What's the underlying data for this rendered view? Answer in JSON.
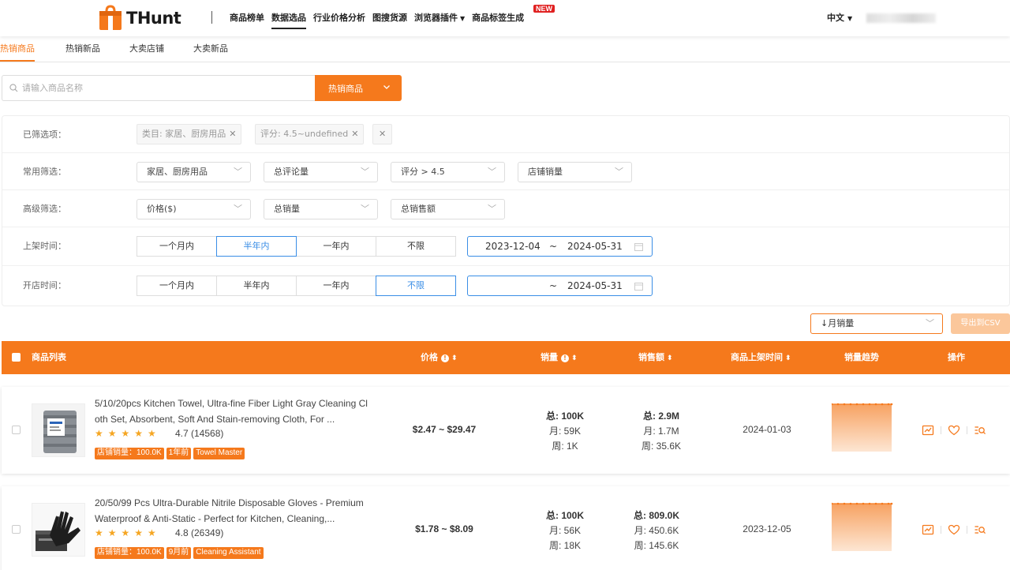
{
  "brand": {
    "name": "THunt",
    "accent": "#f5791c",
    "new_badge": "NEW"
  },
  "nav": {
    "items": [
      {
        "label": "商品榜单"
      },
      {
        "label": "数据选品"
      },
      {
        "label": "行业价格分析"
      },
      {
        "label": "图搜货源"
      },
      {
        "label": "浏览器插件"
      },
      {
        "label": "商品标签生成"
      }
    ],
    "language": "中文"
  },
  "tabs": [
    {
      "label": "热销商品"
    },
    {
      "label": "热销新品"
    },
    {
      "label": "大卖店铺"
    },
    {
      "label": "大卖新品"
    }
  ],
  "search": {
    "placeholder": "请输入商品名称",
    "scope": "热销商品"
  },
  "filters": {
    "selected_label": "已筛选项：",
    "selected_chips": [
      "类目: 家居、厨房用品",
      "评分: 4.5~undefined"
    ],
    "common_label": "常用筛选：",
    "common": [
      "家居、厨房用品",
      "总评论量",
      "评分 > 4.5",
      "店铺销量"
    ],
    "advanced_label": "高级筛选：",
    "advanced": [
      "价格($)",
      "总销量",
      "总销售额"
    ],
    "listed_label": "上架时间：",
    "listed_options": [
      "一个月内",
      "半年内",
      "一年内",
      "不限"
    ],
    "listed_range": {
      "start": "2023-12-04",
      "sep": "~",
      "end": "2024-05-31"
    },
    "shop_label": "开店时间：",
    "shop_options": [
      "一个月内",
      "半年内",
      "一年内",
      "不限"
    ],
    "shop_range": {
      "start": "",
      "sep": "~",
      "end": "2024-05-31"
    }
  },
  "sort": {
    "value": "↓月销量"
  },
  "export_label": "导出到CSV",
  "table": {
    "headers": {
      "list": "商品列表",
      "price": "价格",
      "sales": "销量",
      "revenue": "销售额",
      "listed": "商品上架时间",
      "trend": "销量趋势",
      "ops": "操作"
    },
    "rows": [
      {
        "title": "5/10/20pcs Kitchen Towel, Ultra-fine Fiber Light Gray Cleaning Cloth Set, Absorbent, Soft And Stain-removing Cloth, For ...",
        "stars": "★★★★★",
        "rating": "4.7 (14568)",
        "tags": [
          "店铺销量：100.0K",
          "1年前",
          "Towel Master"
        ],
        "price": "$2.47 ~ $29.47",
        "sales": {
          "total": "总: 100K",
          "month": "月: 59K",
          "week": "周: 1K"
        },
        "revenue": {
          "total": "总: 2.9M",
          "month": "月: 1.7M",
          "week": "周: 35.6K"
        },
        "listed": "2024-01-03"
      },
      {
        "title": "20/50/99 Pcs Ultra-Durable Nitrile Disposable Gloves - Premium Waterproof & Anti-Static - Perfect for Kitchen, Cleaning,...",
        "stars": "★★★★★",
        "rating": "4.8 (26349)",
        "tags": [
          "店铺销量：100.0K",
          "9月前",
          "Cleaning Assistant"
        ],
        "price": "$1.78 ~ $8.09",
        "sales": {
          "total": "总: 100K",
          "month": "月: 56K",
          "week": "周: 18K"
        },
        "revenue": {
          "total": "总: 809.0K",
          "month": "月: 450.6K",
          "week": "周: 145.6K"
        },
        "listed": "2023-12-05"
      }
    ]
  }
}
